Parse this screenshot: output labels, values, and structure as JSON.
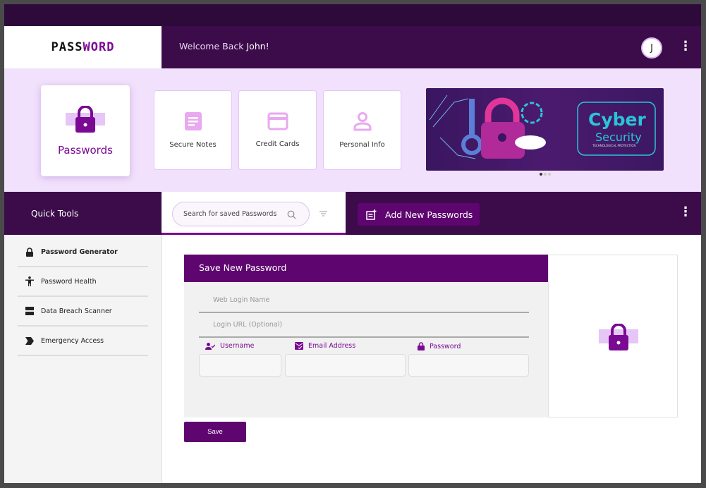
{
  "header": {
    "logo_part1": "PASS",
    "logo_part2": "WORD",
    "welcome": "Welcome Back ",
    "user": "John!",
    "avatar_initial": "J"
  },
  "categories": [
    {
      "label": "Passwords",
      "icon": "lock-icon"
    },
    {
      "label": "Secure Notes",
      "icon": "note-icon"
    },
    {
      "label": "Credit Cards",
      "icon": "credit-card-icon"
    },
    {
      "label": "Personal Info",
      "icon": "person-icon"
    }
  ],
  "banner": {
    "title1": "Cyber",
    "title2": "Security",
    "subtitle": "TECHNOLOGICAL PROTECTION",
    "slides": 3,
    "active_slide": 1
  },
  "toolbar": {
    "quick_tools": "Quick Tools",
    "search_placeholder": "Search for saved Passwords",
    "add_label": "Add New Passwords"
  },
  "sidebar": [
    {
      "label": "Password Generator"
    },
    {
      "label": "Password Health"
    },
    {
      "label": "Data Breach Scanner"
    },
    {
      "label": "Emergency Access"
    }
  ],
  "form": {
    "title": "Save New Password",
    "web_login_placeholder": "Web Login Name",
    "url_placeholder": "Login URL (Optional)",
    "username_label": "Username",
    "email_label": "Email Address",
    "password_label": "Password",
    "save_label": "Save"
  },
  "colors": {
    "primary": "#5e0570",
    "dark": "#3c0b4a",
    "light": "#f1e1fc"
  }
}
